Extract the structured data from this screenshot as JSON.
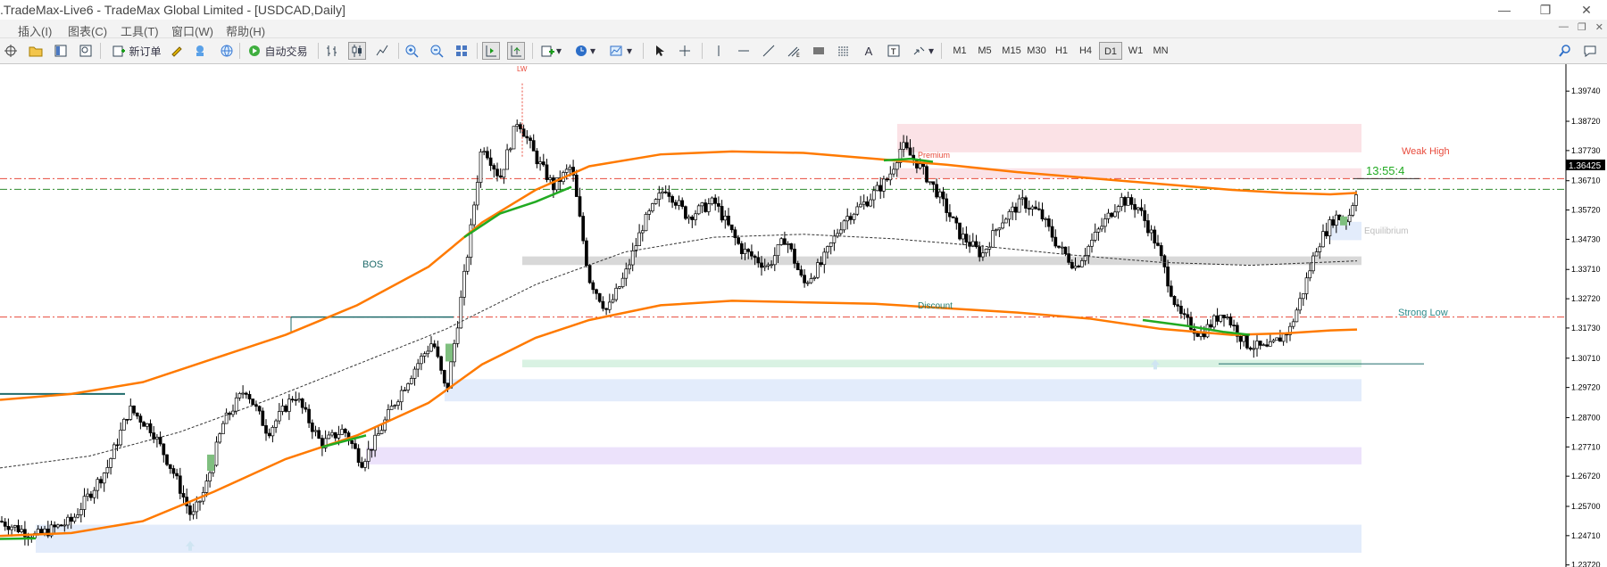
{
  "window": {
    "title": ".TradeMax-Live6 - TradeMax Global Limited - [USDCAD,Daily]",
    "controls": [
      "—",
      "❐",
      "✕"
    ]
  },
  "menu": {
    "items": [
      "插入(I)",
      "图表(C)",
      "工具(T)",
      "窗口(W)",
      "帮助(H)"
    ],
    "mdi_controls": [
      "—",
      "❐",
      "✕"
    ]
  },
  "toolbar": {
    "new_order_label": "新订单",
    "auto_trading_label": "自动交易",
    "timeframes": [
      "M1",
      "M5",
      "M15",
      "M30",
      "H1",
      "H4",
      "D1",
      "W1",
      "MN"
    ],
    "active_timeframe": "D1",
    "icons": [
      "crosshair-icon",
      "folder-icon",
      "market-watch-icon",
      "navigator-icon",
      "new-order-icon",
      "metaeditor-icon",
      "signals-icon",
      "auto-trading-icon",
      "bar-chart-icon",
      "candlestick-icon",
      "line-chart-icon",
      "zoom-in-icon",
      "zoom-out-icon",
      "tile-icon",
      "chart-shift-icon",
      "autoscroll-icon",
      "indicators-icon",
      "periods-icon",
      "templates-icon",
      "cursor-icon",
      "crosshair-tool-icon",
      "vertical-line-icon",
      "horizontal-line-icon",
      "trendline-icon",
      "fibonacci-icon",
      "rectangle-icon",
      "channel-icon",
      "text-icon",
      "label-icon",
      "arrows-icon",
      "search-icon",
      "chat-icon"
    ]
  },
  "chart_data": {
    "type": "candlestick",
    "symbol": "USDCAD",
    "timeframe": "Daily",
    "y_ticks": [
      "1.39740",
      "1.38720",
      "1.37730",
      "1.36710",
      "1.35720",
      "1.34730",
      "1.33710",
      "1.32720",
      "1.31730",
      "1.30710",
      "1.29720",
      "1.28700",
      "1.27710",
      "1.26720",
      "1.25700",
      "1.24710",
      "1.23720"
    ],
    "ylim": [
      1.2365,
      1.4065
    ],
    "current_price": "1.36425",
    "countdown": "13:55:4",
    "labels": {
      "weak_high": "Weak High",
      "strong_low": "Strong Low",
      "equilibrium": "Equilibrium",
      "discount": "Discount",
      "premium": "Premium",
      "bos": "BOS",
      "lw": "LW"
    },
    "colors": {
      "bull": "#000000",
      "band": "#ff7a00",
      "band_green": "#22aa22",
      "red_level": "#e84b3c",
      "green_level": "#2e8b2e",
      "premium_zone": "#fbe2e6",
      "discount_zone": "#d9f2e3",
      "equilibrium_zone": "#d8d8d8",
      "blue_zone": "#e3ecfb",
      "purple_zone": "#ece2fb",
      "dark_teal": "#1f6b6b"
    }
  }
}
